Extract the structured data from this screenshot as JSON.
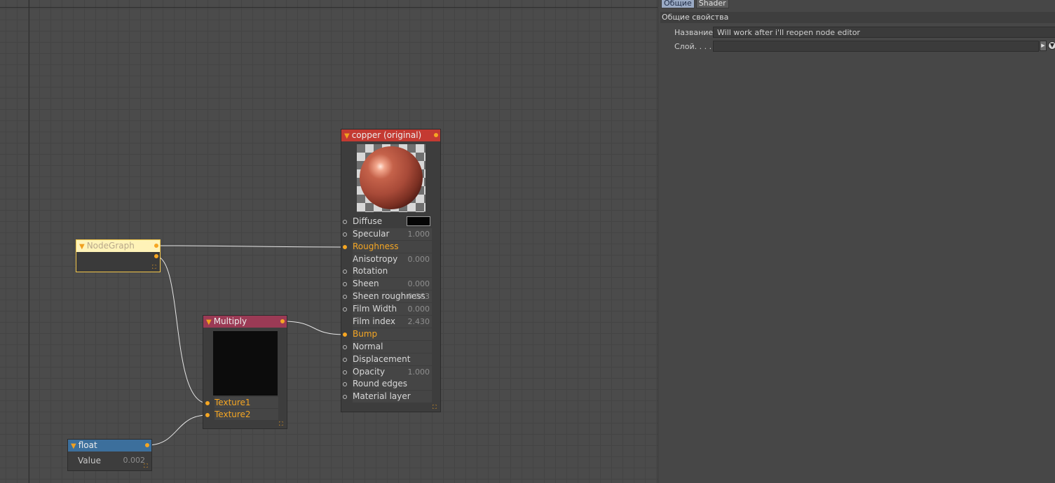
{
  "editor": {
    "nodes": {
      "copper": {
        "title": "copper (original)",
        "header_color": "#c43a32",
        "params": [
          {
            "label": "Diffuse",
            "value": "",
            "kind": "swatch",
            "swatch_color": "#050505"
          },
          {
            "label": "Specular",
            "value": "1.000"
          },
          {
            "label": "Roughness",
            "value": "",
            "connected": true
          },
          {
            "label": "Anisotropy",
            "value": "0.000"
          },
          {
            "label": "Rotation",
            "value": ""
          },
          {
            "label": "Sheen",
            "value": "0.000"
          },
          {
            "label": "Sheen roughness",
            "value": "0.063"
          },
          {
            "label": "Film Width",
            "value": "0.000"
          },
          {
            "label": "Film index",
            "value": "2.430"
          },
          {
            "label": "Bump",
            "value": "",
            "connected": true
          },
          {
            "label": "Normal",
            "value": ""
          },
          {
            "label": "Displacement",
            "value": ""
          },
          {
            "label": "Opacity",
            "value": "1.000"
          },
          {
            "label": "Round edges",
            "value": ""
          },
          {
            "label": "Material layer",
            "value": ""
          }
        ]
      },
      "nodegraph": {
        "title": "NodeGraph",
        "header_color": "#fff3b8"
      },
      "multiply": {
        "title": "Multiply",
        "header_color": "#9b3a55",
        "inputs": [
          "Texture1",
          "Texture2"
        ]
      },
      "float": {
        "title": "float",
        "header_color": "#3c6f9c",
        "param_label": "Value",
        "param_value": "0.002"
      }
    },
    "accent_color": "#f5a623"
  },
  "panel": {
    "tabs": [
      "Общие",
      "Shader"
    ],
    "active_tab": "Общие",
    "section_title": "Общие свойства",
    "fields": {
      "name_label": "Название",
      "name_value": "Will work after i'll reopen node editor",
      "layer_label": "Слой. . . .",
      "layer_value": ""
    }
  }
}
